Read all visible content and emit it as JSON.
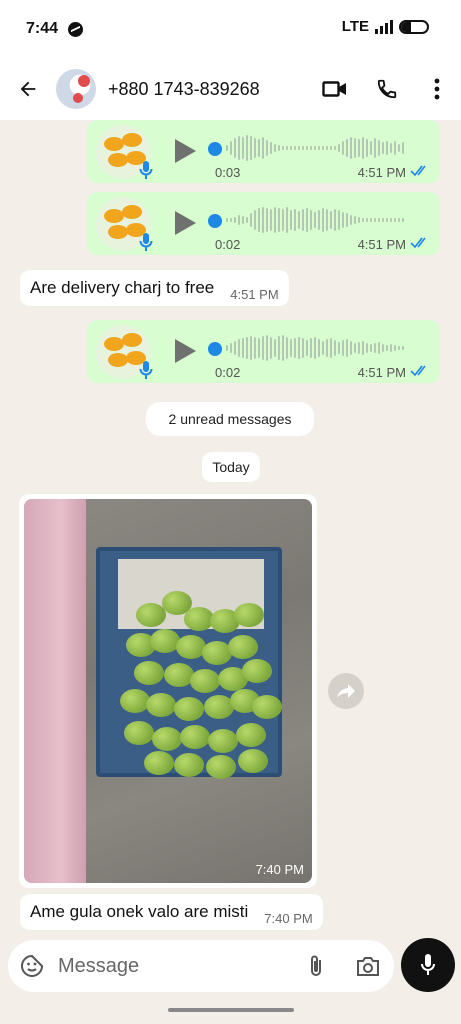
{
  "status_bar": {
    "time": "7:44",
    "network": "LTE"
  },
  "header": {
    "contact": "+880 1743-839268"
  },
  "voice_messages": [
    {
      "duration": "0:03",
      "time": "4:51 PM"
    },
    {
      "duration": "0:02",
      "time": "4:51 PM"
    },
    {
      "duration": "0:02",
      "time": "4:51 PM"
    }
  ],
  "incoming_text_1": {
    "text": "Are delivery charj to free",
    "time": "4:51 PM"
  },
  "unread_pill": "2 unread messages",
  "date_pill": "Today",
  "image_message": {
    "time": "7:40 PM"
  },
  "incoming_text_2": {
    "text": "Ame gula onek valo are misti",
    "time": "7:40 PM"
  },
  "composer": {
    "placeholder": "Message"
  }
}
